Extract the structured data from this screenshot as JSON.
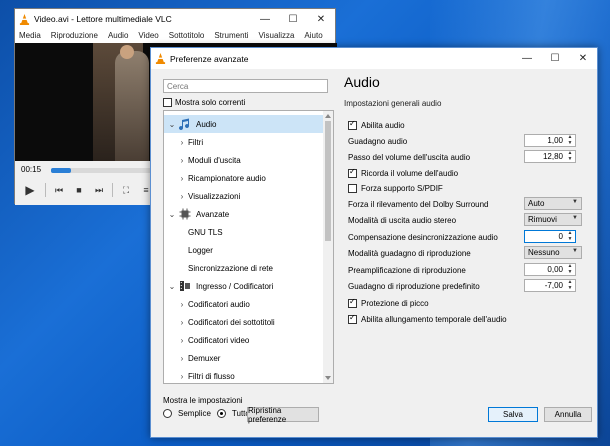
{
  "vlc": {
    "title": "Video.avi - Lettore multimediale VLC",
    "menu": [
      "Media",
      "Riproduzione",
      "Audio",
      "Video",
      "Sottotitolo",
      "Strumenti",
      "Visualizza",
      "Aiuto"
    ],
    "time": "00:15",
    "progress": 0.19
  },
  "dialog": {
    "title": "Preferenze avanzate",
    "search_placeholder": "Cerca",
    "only_current": "Mostra solo correnti",
    "tree": [
      {
        "label": "Audio",
        "level": 0,
        "arrow": "⌄",
        "icon": "music-note-icon",
        "selected": true
      },
      {
        "label": "Filtri",
        "level": 1,
        "arrow": "›"
      },
      {
        "label": "Moduli d'uscita",
        "level": 1,
        "arrow": "›"
      },
      {
        "label": "Ricampionatore audio",
        "level": 1,
        "arrow": "›"
      },
      {
        "label": "Visualizzazioni",
        "level": 1,
        "arrow": "›"
      },
      {
        "label": "Avanzate",
        "level": 0,
        "arrow": "⌄",
        "icon": "cpu-chip-icon"
      },
      {
        "label": "GNU TLS",
        "level": 1,
        "arrow": ""
      },
      {
        "label": "Logger",
        "level": 1,
        "arrow": ""
      },
      {
        "label": "Sincronizzazione di rete",
        "level": 1,
        "arrow": ""
      },
      {
        "label": "Ingresso / Codificatori",
        "level": 0,
        "arrow": "⌄",
        "icon": "film-strip-icon"
      },
      {
        "label": "Codificatori audio",
        "level": 1,
        "arrow": "›"
      },
      {
        "label": "Codificatori dei sottotitoli",
        "level": 1,
        "arrow": "›"
      },
      {
        "label": "Codificatori video",
        "level": 1,
        "arrow": "›"
      },
      {
        "label": "Demuxer",
        "level": 1,
        "arrow": "›"
      },
      {
        "label": "Filtri di flusso",
        "level": 1,
        "arrow": "›"
      }
    ],
    "show_settings": "Mostra le impostazioni",
    "radio_simple": "Semplice",
    "radio_all": "Tutto",
    "reset_button": "Ripristina preferenze",
    "save_button": "Salva",
    "cancel_button": "Annulla",
    "panel": {
      "title": "Audio",
      "subtitle": "Impostazioni generali audio",
      "enable_audio": "Abilita audio",
      "gain_label": "Guadagno audio",
      "gain_value": "1,00",
      "volume_step_label": "Passo del volume dell'uscita audio",
      "volume_step_value": "12,80",
      "remember_volume": "Ricorda il volume dell'audio",
      "force_spdif": "Forza supporto S/PDIF",
      "dolby_label": "Forza il rilevamento del Dolby Surround",
      "dolby_value": "Auto",
      "stereo_label": "Modalità di uscita audio stereo",
      "stereo_value": "Rimuovi",
      "desync_label": "Compensazione desincronizzazione audio",
      "desync_value": "0",
      "replay_mode_label": "Modalità guadagno di riproduzione",
      "replay_mode_value": "Nessuno",
      "preamp_label": "Preamplificazione di riproduzione",
      "preamp_value": "0,00",
      "default_gain_label": "Guadagno di riproduzione predefinito",
      "default_gain_value": "-7,00",
      "peak_protection": "Protezione di picco",
      "time_stretch": "Abilita allungamento temporale dell'audio"
    }
  }
}
